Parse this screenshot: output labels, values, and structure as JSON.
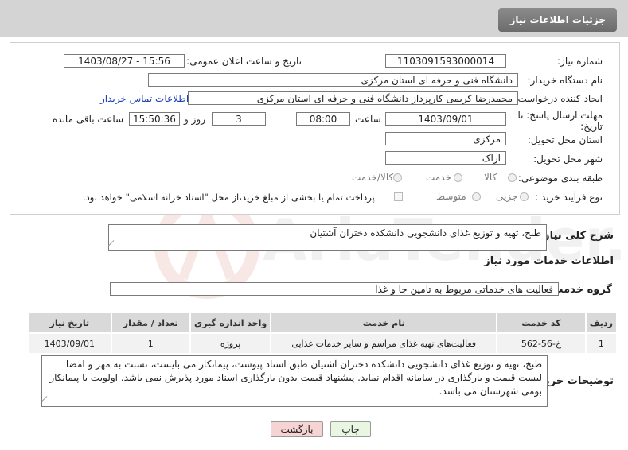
{
  "header": {
    "title": "جزئیات اطلاعات نیاز"
  },
  "form": {
    "need_number": {
      "label": "شماره نیاز:",
      "value": "1103091593000014"
    },
    "announce_datetime": {
      "label": "تاریخ و ساعت اعلان عمومی:",
      "value": "1403/08/27 - 15:56"
    },
    "buyer_org": {
      "label": "نام دستگاه خریدار:",
      "value": "دانشگاه فنی و حرفه ای استان مرکزی"
    },
    "requester": {
      "label": "ایجاد کننده درخواست:",
      "value": "محمدرضا کریمی کارپرداز  دانشگاه فنی و حرفه ای استان مرکزی",
      "contact_link": "اطلاعات تماس خریدار"
    },
    "deadline": {
      "label_line1": "مهلت ارسال پاسخ: تا",
      "label_line2": "تاریخ:",
      "date": "1403/09/01",
      "time_label": "ساعت",
      "time": "08:00",
      "days": "3",
      "days_label": "روز و",
      "remaining": "15:50:36",
      "remaining_label": "ساعت باقی مانده"
    },
    "province": {
      "label": "استان محل تحویل:",
      "value": "مرکزی"
    },
    "city": {
      "label": "شهر محل تحویل:",
      "value": "اراک"
    },
    "category": {
      "label": "طبقه بندی موضوعی:",
      "options": [
        "کالا",
        "خدمت",
        "کالا/خدمت"
      ]
    },
    "purchase_type": {
      "label": "نوع فرآیند خرید :",
      "options": [
        "جزیی",
        "متوسط"
      ],
      "note": "پرداخت تمام یا بخشی از مبلغ خرید،از محل \"اسناد خزانه اسلامی\" خواهد بود."
    }
  },
  "summary": {
    "label": "شرح کلی نیاز:",
    "value": "طبخ، تهیه و توزیع غذای دانشجویی دانشکده دختران آشتیان"
  },
  "services_section": {
    "title": "اطلاعات خدمات مورد نیاز",
    "group_label": "گروه خدمت:",
    "group_value": "فعالیت های خدماتی مربوط به تامین جا و غذا"
  },
  "table": {
    "headers": [
      "ردیف",
      "کد خدمت",
      "نام خدمت",
      "واحد اندازه گیری",
      "تعداد / مقدار",
      "تاریخ نیاز"
    ],
    "rows": [
      [
        "1",
        "خ-56-562",
        "فعالیت‌های تهیه غذای مراسم و سایر خدمات غذایی",
        "پروژه",
        "1",
        "1403/09/01"
      ]
    ]
  },
  "buyer_notes": {
    "label": "توضیحات خریدار:",
    "value": "طبخ، تهیه و توزیع غذای دانشجویی دانشکده دختران آشتیان طبق اسناد پیوست، پیمانکار می بایست، نسبت به مهر و امضا لیست قیمت و بارگذاری در سامانه اقدام نماید. پیشنهاد قیمت بدون بارگذاری اسناد مورد پذیرش نمی باشد. اولویت با پیمانکار بومی شهرستان می باشد."
  },
  "buttons": {
    "print": "چاپ",
    "back": "بازگشت"
  },
  "watermark": {
    "text": "AriaTender.neT"
  },
  "colors": {
    "header_btn": "#7a7a7a",
    "back_btn": "#f7d4d4",
    "print_btn": "#e9f6e2",
    "link": "#1a3fb0"
  }
}
